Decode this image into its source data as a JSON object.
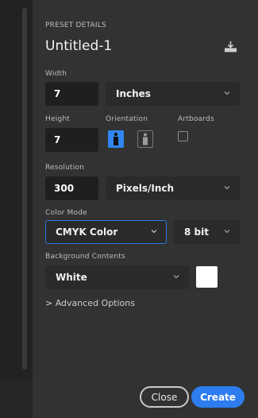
{
  "panel": {
    "section_title": "PRESET DETAILS",
    "document_name": "Untitled-1",
    "width": {
      "label": "Width",
      "value": "7",
      "unit": "Inches"
    },
    "height": {
      "label": "Height",
      "value": "7"
    },
    "orientation": {
      "label": "Orientation",
      "selected": "portrait"
    },
    "artboards": {
      "label": "Artboards",
      "checked": false
    },
    "resolution": {
      "label": "Resolution",
      "value": "300",
      "unit": "Pixels/Inch"
    },
    "color_mode": {
      "label": "Color Mode",
      "value": "CMYK Color",
      "bit_depth": "8 bit"
    },
    "background_contents": {
      "label": "Background Contents",
      "value": "White",
      "swatch_color": "#ffffff"
    },
    "advanced_options": "> Advanced Options"
  },
  "buttons": {
    "close": "Close",
    "create": "Create"
  },
  "colors": {
    "accent": "#2d7df0",
    "panel_bg": "#323232",
    "field_bg": "#1f1f1f"
  },
  "icons": [
    "save-preset-icon",
    "portrait-orientation-icon",
    "landscape-orientation-icon",
    "chevron-down-icon"
  ]
}
